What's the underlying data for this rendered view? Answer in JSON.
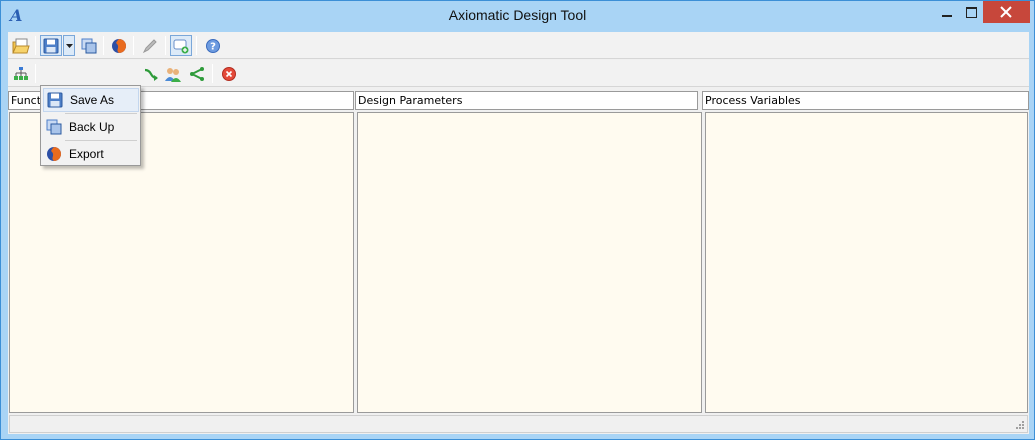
{
  "window": {
    "title": "Axiomatic Design Tool",
    "app_icon_glyph": "A",
    "controls": [
      "minimize-icon",
      "maximize-icon",
      "close-icon"
    ]
  },
  "toolbar1": {
    "buttons": [
      "open-icon",
      "save-icon",
      "dropdown-arrow-icon",
      "copy-icon",
      "firefox-export-icon",
      "pen-icon",
      "comment-add-icon",
      "help-icon"
    ]
  },
  "toolbar2": {
    "buttons": [
      "hierarchy-icon",
      "arrow-right-icon",
      "users-icon",
      "branch-icon",
      "cancel-icon"
    ]
  },
  "panes": {
    "functional": {
      "header": "Functi"
    },
    "design": {
      "header": "Design Parameters"
    },
    "process": {
      "header": "Process Variables"
    }
  },
  "save_menu": {
    "items": [
      {
        "label": "Save As",
        "icon": "save-icon"
      },
      {
        "label": "Back Up",
        "icon": "backup-icon"
      },
      {
        "label": "Export",
        "icon": "firefox-icon"
      }
    ]
  },
  "colors": {
    "titlebar": "#a9d4f5",
    "pane_background": "#fffbf0",
    "close_button": "#c7473b",
    "accent_blue": "#2b6fc0"
  }
}
